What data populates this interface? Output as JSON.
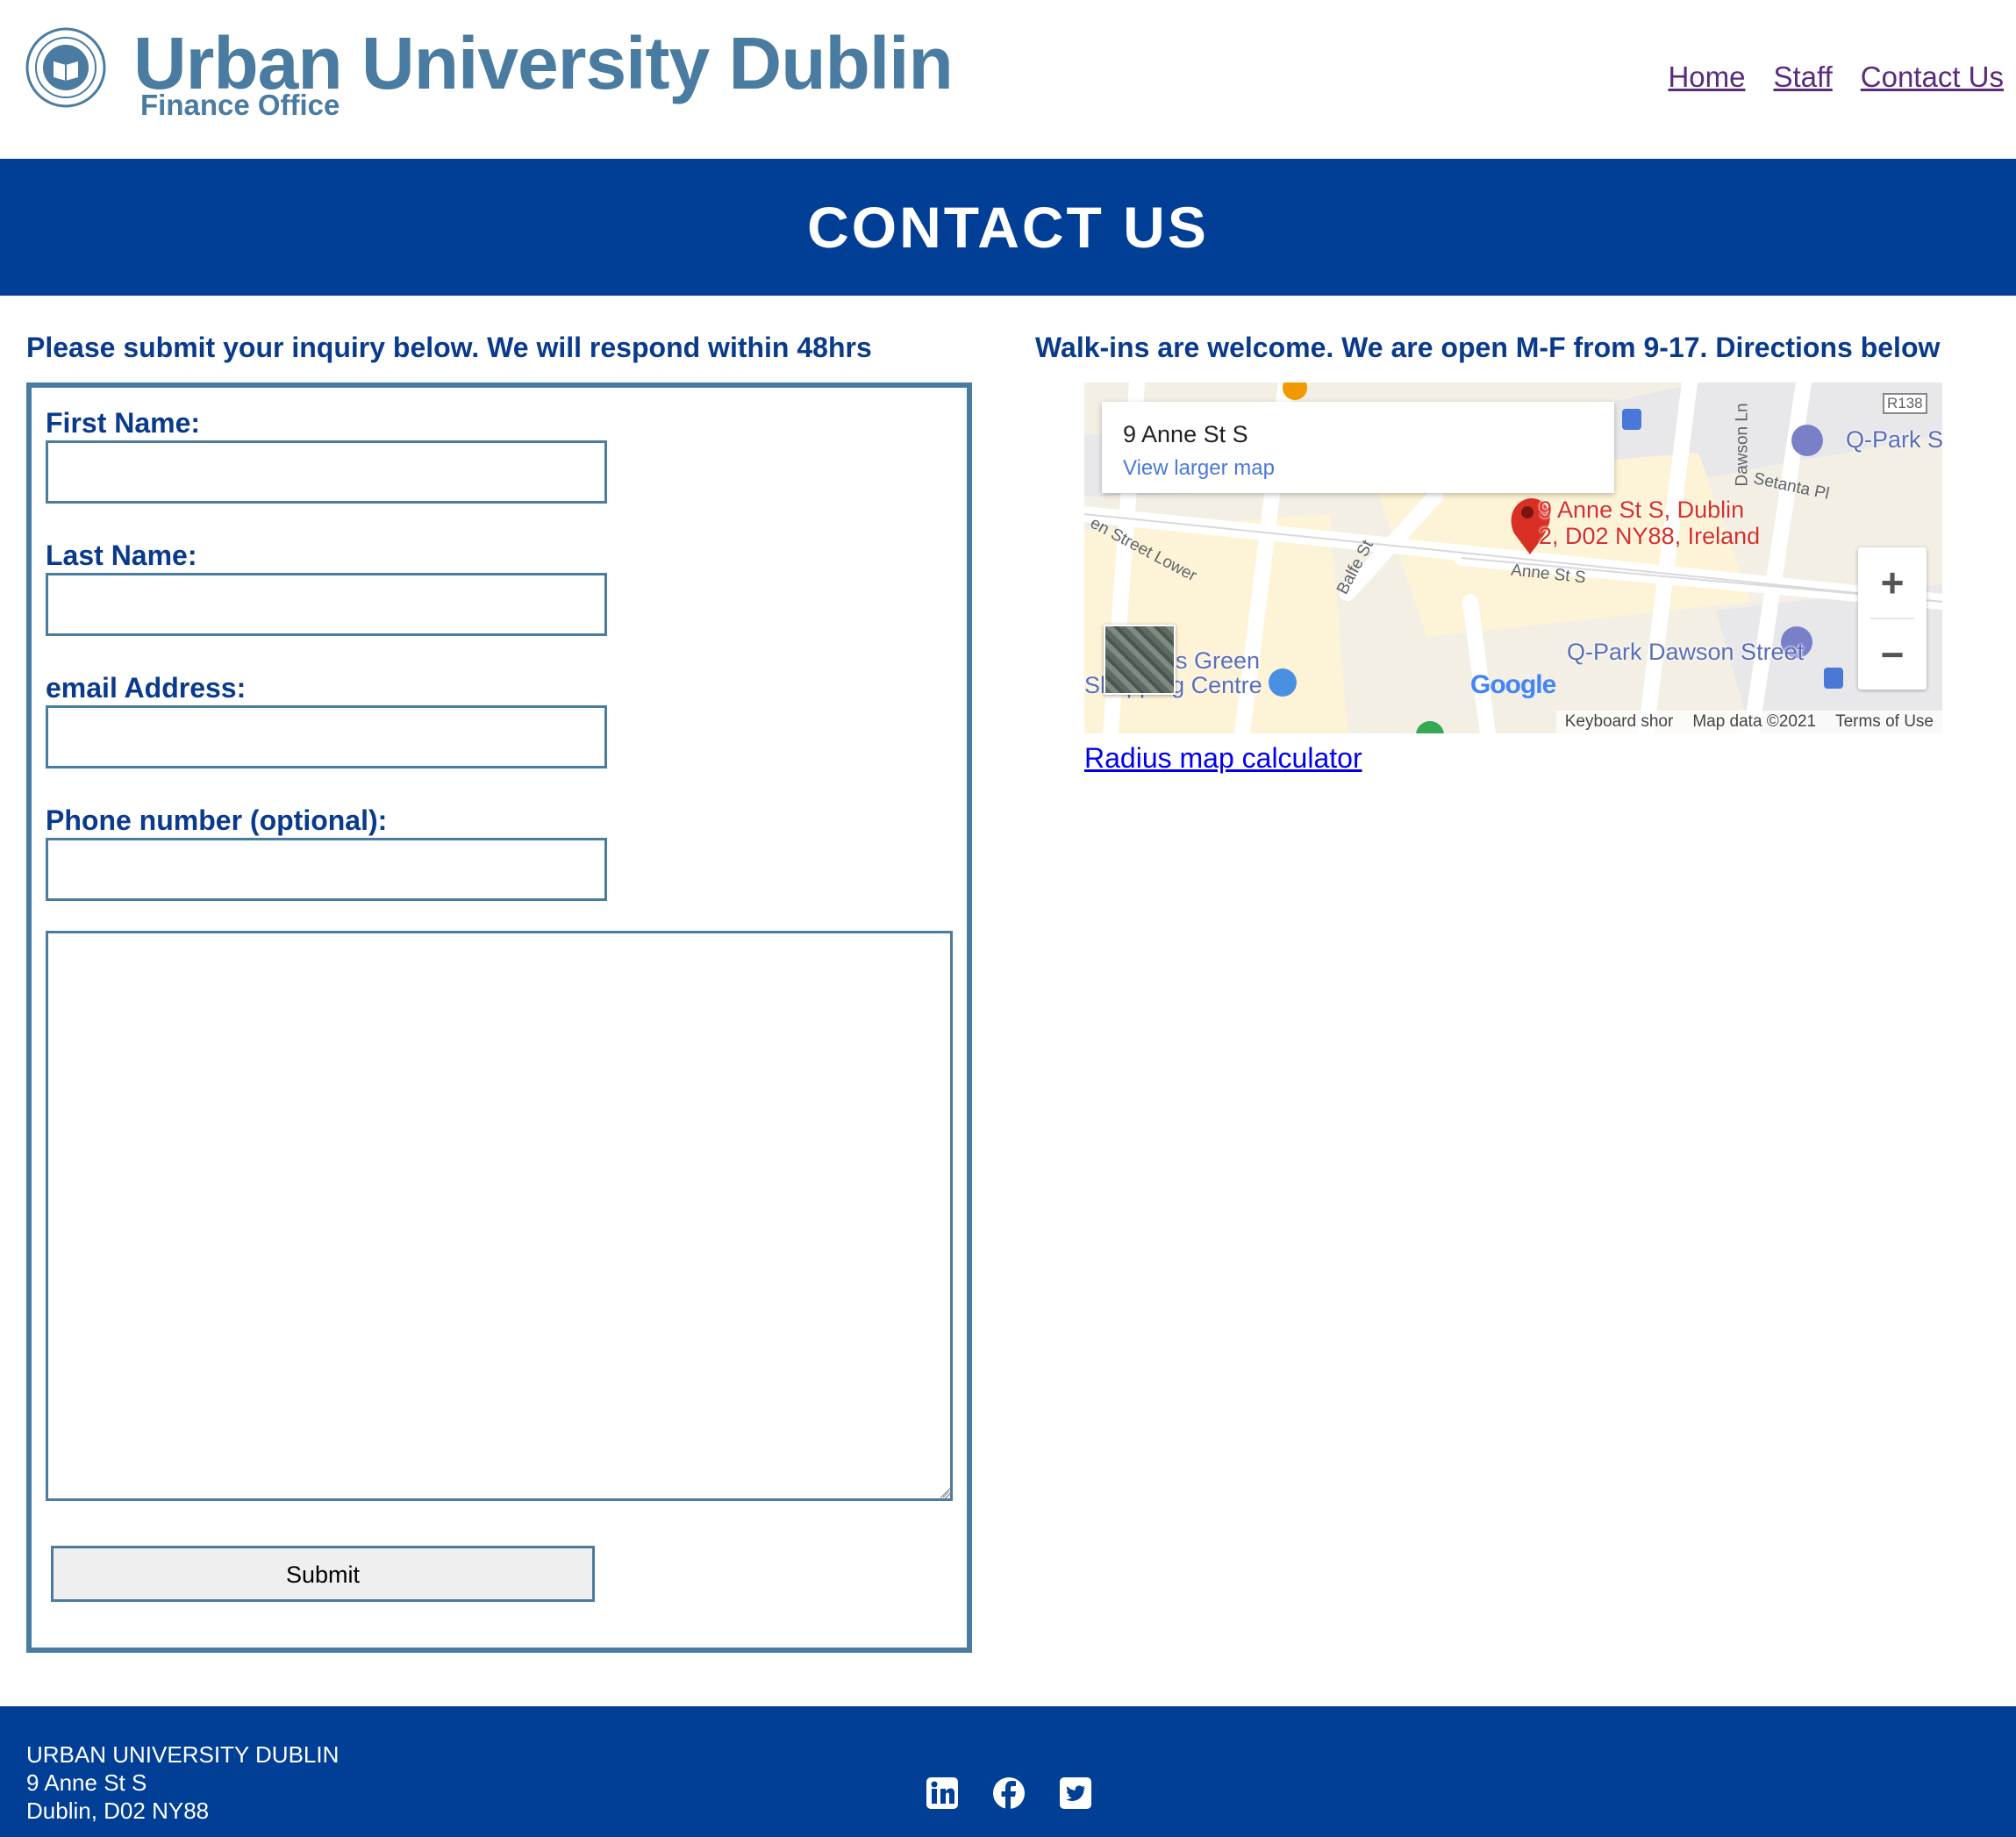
{
  "header": {
    "title": "Urban University Dublin",
    "subtitle": "Finance Office",
    "nav": [
      {
        "label": "Home"
      },
      {
        "label": "Staff"
      },
      {
        "label": "Contact Us"
      }
    ]
  },
  "banner": {
    "title": "CONTACT US"
  },
  "form": {
    "intro": "Please submit your inquiry below. We will respond within 48hrs",
    "first_name_label": "First Name:",
    "first_name_value": "",
    "last_name_label": "Last Name:",
    "last_name_value": "",
    "email_label": "email Address:",
    "email_value": "",
    "phone_label": "Phone number (optional):",
    "phone_value": "",
    "message_value": "",
    "submit_label": "Submit"
  },
  "directions": {
    "intro": "Walk-ins are welcome. We are open M-F from 9-17. Directions below",
    "map": {
      "card_title": "9 Anne St S",
      "card_link": "View larger map",
      "pin_label_line1": "9 Anne St S, Dublin",
      "pin_label_line2": "2, D02 NY88, Ireland",
      "poi_qpark_dawson": "Q-Park Dawson Street",
      "poi_qpark_s": "Q-Park S",
      "poi_green": "s Green",
      "poi_shopping": "Shopping Centre",
      "street_anne": "Anne St S",
      "street_setanta": "Setanta Pl",
      "street_dawson_ln": "Dawson Ln",
      "street_balfe": "Balfe St",
      "street_lower": "en Street Lower",
      "road_r138": "R138",
      "google_logo": "Google",
      "footer_shortcuts": "Keyboard shor",
      "footer_mapdata": "Map data ©2021",
      "footer_terms": "Terms of Use",
      "zoom_in": "+",
      "zoom_out": "−"
    },
    "radius_link": "Radius map calculator"
  },
  "footer": {
    "org": "URBAN UNIVERSITY DUBLIN",
    "address_line1": "9 Anne St S",
    "address_line2": "Dublin, D02 NY88",
    "social_icons": [
      "linkedin-icon",
      "facebook-icon",
      "twitter-icon"
    ]
  },
  "colors": {
    "brand_blue": "#003f95",
    "title_blue": "#4a7ba0",
    "text_navy": "#0a3a8c",
    "nav_link": "#5b2a7d"
  }
}
